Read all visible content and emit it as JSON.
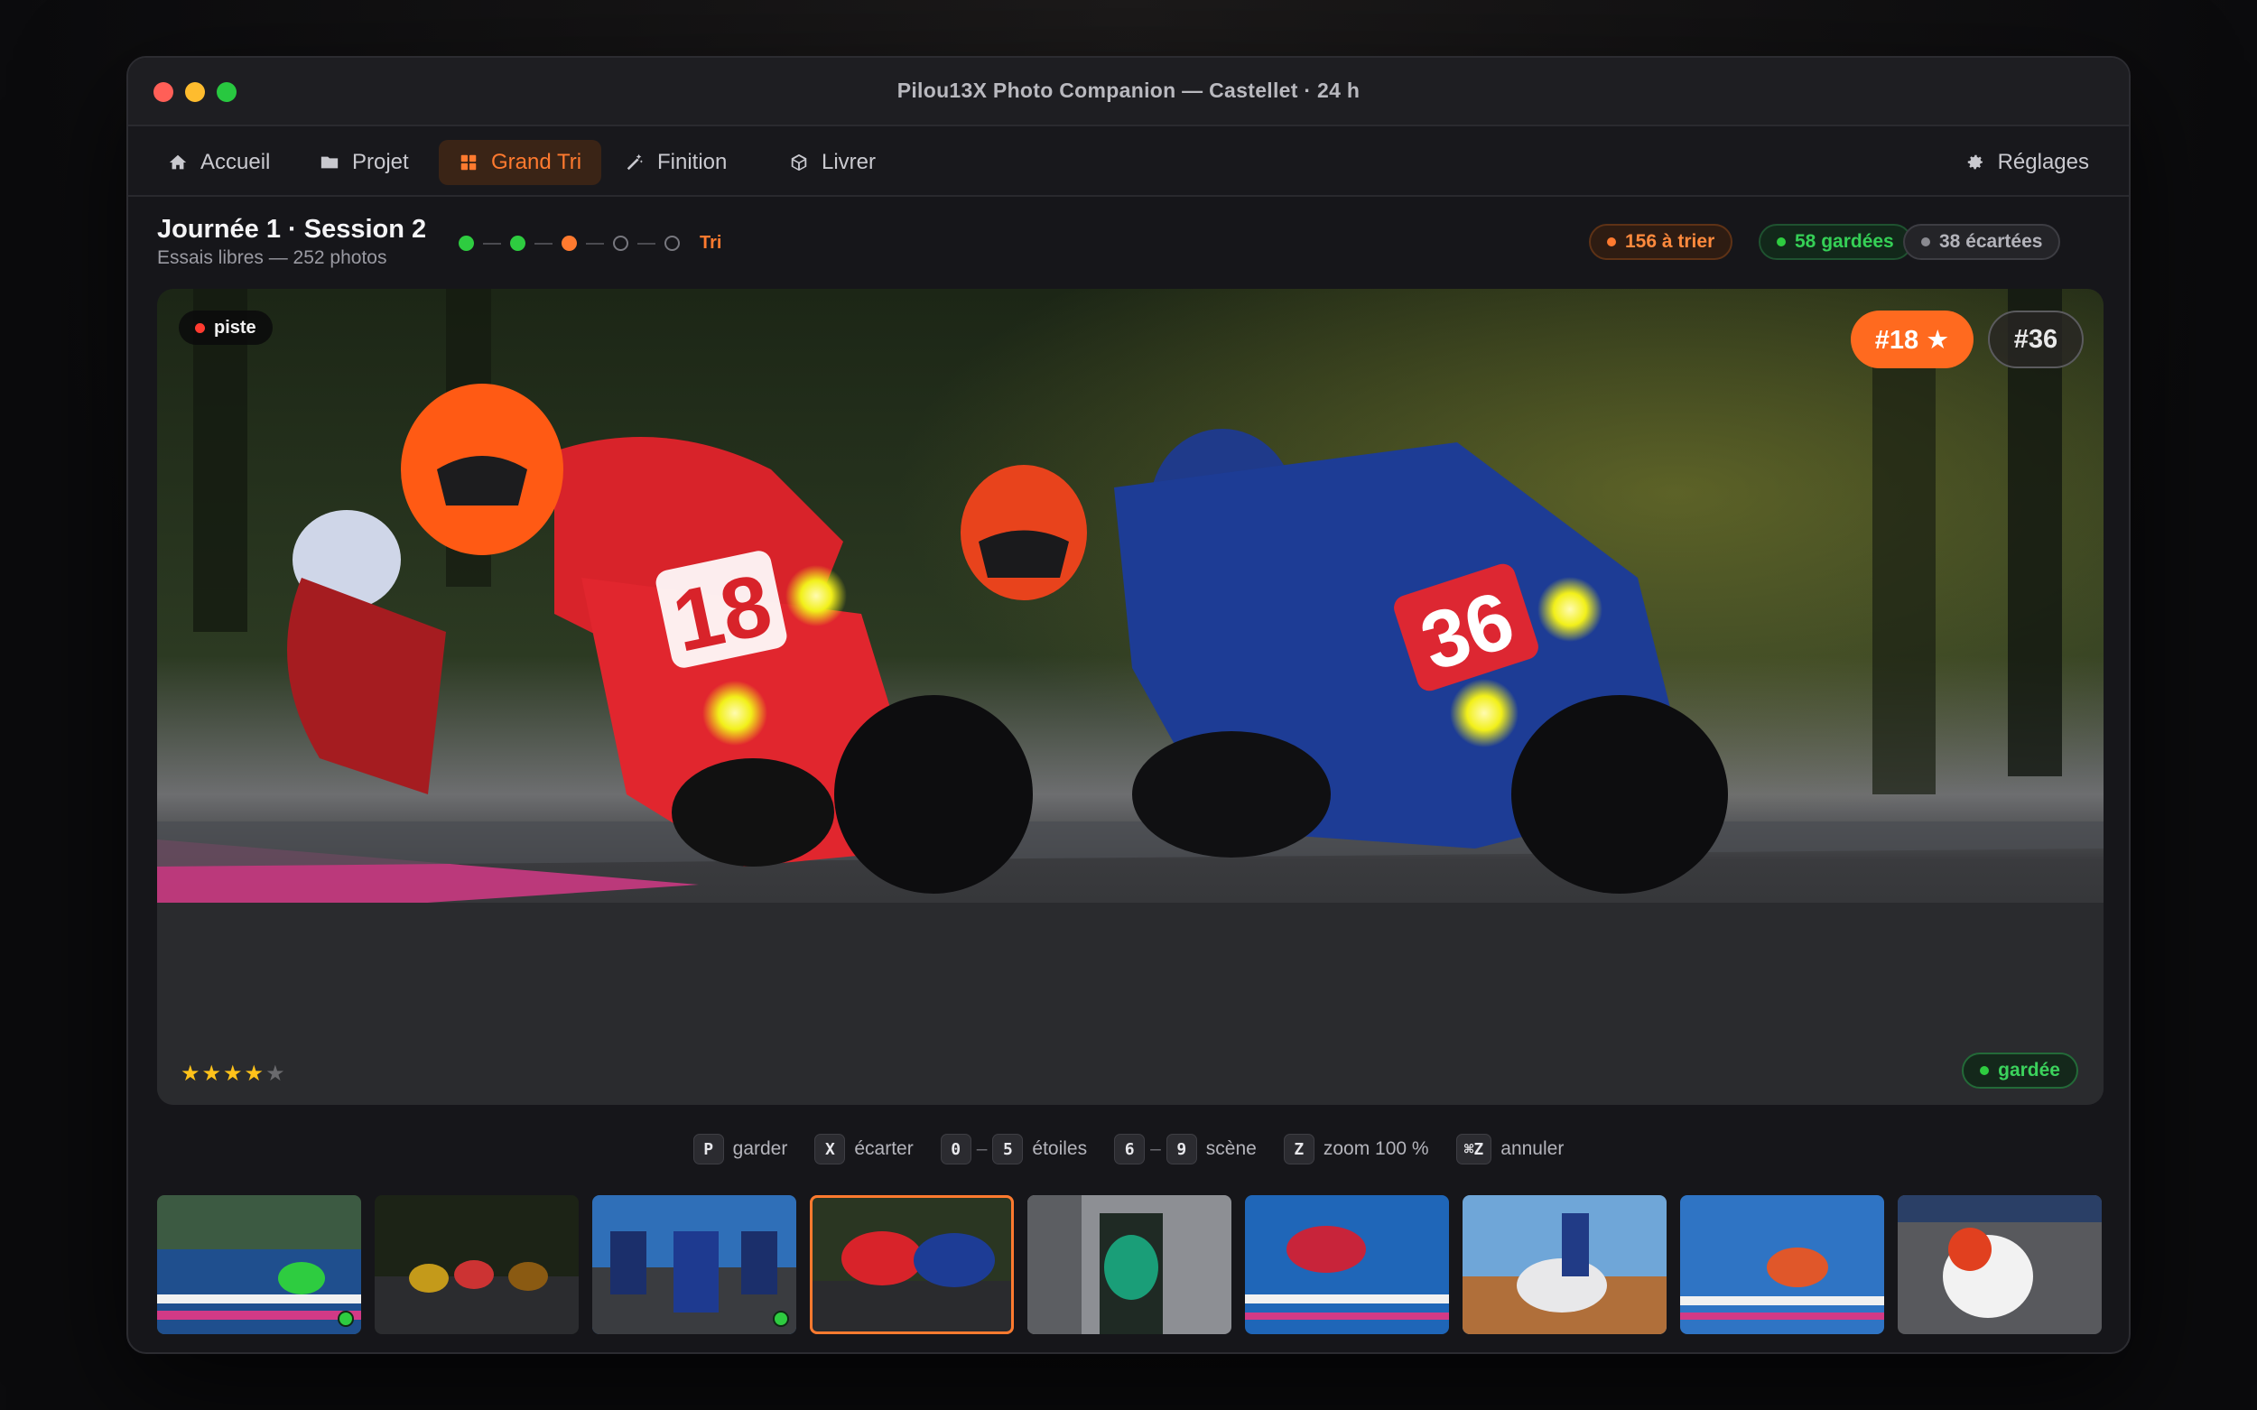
{
  "window": {
    "title": "Pilou13X Photo Companion — Castellet · 24 h"
  },
  "nav": {
    "tabs": [
      {
        "label": "Accueil",
        "icon": "home-icon"
      },
      {
        "label": "Projet",
        "icon": "folder-icon"
      },
      {
        "label": "Grand Tri",
        "icon": "grid-icon",
        "active": true
      },
      {
        "label": "Finition",
        "icon": "magic-wand-icon"
      },
      {
        "label": "Livrer",
        "icon": "box-icon"
      }
    ],
    "settings_label": "Réglages"
  },
  "session": {
    "title": "Journée 1 · Session 2",
    "subtitle": "Essais libres — 252 photos",
    "progress": {
      "steps_done": 2,
      "current_step": 3,
      "total_steps": 5,
      "current_label": "Tri"
    }
  },
  "counts": {
    "to_sort": "156 à trier",
    "kept": "58 gardées",
    "discarded": "38 écartées"
  },
  "photo": {
    "scene_tag": "piste",
    "subjects": [
      "#18 ★",
      "#36"
    ],
    "rating": 4,
    "rating_max": 5,
    "status": "gardée",
    "plates": [
      "18",
      "36"
    ]
  },
  "shortcuts": [
    {
      "keys": [
        "P"
      ],
      "label": "garder"
    },
    {
      "keys": [
        "X"
      ],
      "label": "écarter"
    },
    {
      "keys": [
        "0",
        "5"
      ],
      "label": "étoiles"
    },
    {
      "keys": [
        "6",
        "9"
      ],
      "label": "scène"
    },
    {
      "keys": [
        "Z"
      ],
      "label": "zoom 100 %"
    },
    {
      "keys": [
        "⌘Z"
      ],
      "label": "annuler"
    }
  ],
  "filmstrip": {
    "selected_index": 3,
    "kept_indices": [
      0,
      2
    ],
    "count": 9
  },
  "colors": {
    "accent": "#ff7a2f",
    "kept": "#2ecc40",
    "background": "#16161a"
  }
}
